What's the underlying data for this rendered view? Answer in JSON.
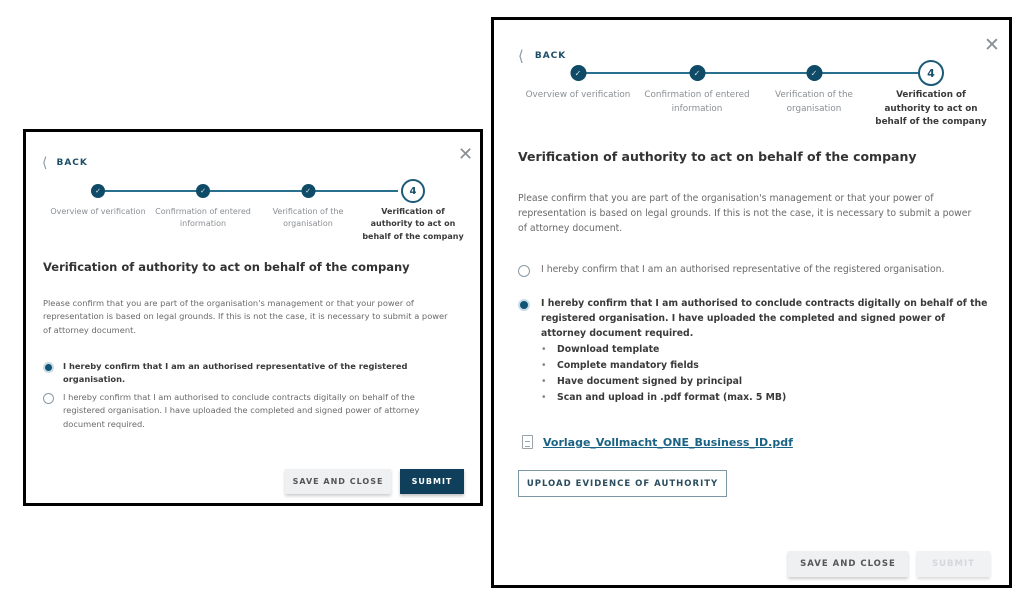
{
  "dialogs": [
    {
      "back_label": "BACK",
      "steps": [
        {
          "label": "Overview of verification",
          "state": "done"
        },
        {
          "label": "Confirmation of entered information",
          "state": "done"
        },
        {
          "label": "Verification of the organisation",
          "state": "done"
        },
        {
          "label": "Verification of authority to act on behalf of the company",
          "state": "current",
          "number": "4"
        }
      ],
      "title": "Verification of authority to act on behalf of the company",
      "description": "Please confirm that you are part of the organisation's management or that your power of representation is based on legal grounds. If this is not the case, it is necessary to submit a power of attorney document.",
      "options": [
        {
          "text": "I hereby confirm that I am an authorised representative of the registered organisation.",
          "checked": true
        },
        {
          "text": "I hereby confirm that I am authorised to conclude contracts digitally on behalf of the registered organisation. I have uploaded the completed and signed power of attorney document required.",
          "checked": false
        }
      ],
      "save_label": "SAVE AND CLOSE",
      "submit_label": "SUBMIT",
      "submit_enabled": true
    },
    {
      "back_label": "BACK",
      "steps": [
        {
          "label": "Overview of verification",
          "state": "done"
        },
        {
          "label": "Confirmation of entered information",
          "state": "done"
        },
        {
          "label": "Verification of the organisation",
          "state": "done"
        },
        {
          "label": "Verification of authority to act on behalf of the company",
          "state": "current",
          "number": "4"
        }
      ],
      "title": "Verification of authority to act on behalf of the company",
      "description": "Please confirm that you are part of the organisation's management or that your power of representation is based on legal grounds. If this is not the case, it is necessary to submit a power of attorney document.",
      "options": [
        {
          "text": "I hereby confirm that I am an authorised representative of the registered organisation.",
          "checked": false
        },
        {
          "text": "I hereby confirm that I am authorised to conclude contracts digitally on behalf of the registered organisation. I have uploaded the completed and signed power of attorney document required.",
          "checked": true
        }
      ],
      "instructions": [
        "Download template",
        "Complete mandatory fields",
        "Have document signed by principal",
        "Scan and upload in .pdf format (max. 5 MB)"
      ],
      "template_file": "Vorlage_Vollmacht_ONE_Business_ID.pdf",
      "upload_label": "UPLOAD EVIDENCE OF AUTHORITY",
      "save_label": "SAVE AND CLOSE",
      "submit_label": "SUBMIT",
      "submit_enabled": false
    }
  ],
  "colors": {
    "primary": "#0f3f5a",
    "step_done": "#0f4b67",
    "link": "#1a6384"
  }
}
